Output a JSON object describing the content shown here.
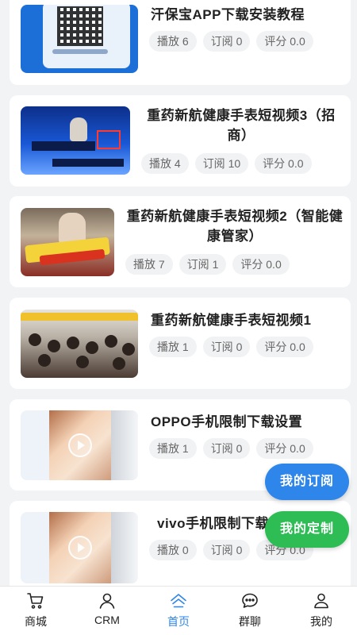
{
  "feed": {
    "items": [
      {
        "title": "汗保宝APP下载安装教程",
        "play": "播放 6",
        "subscribe": "订阅 0",
        "rating": "评分 0.0"
      },
      {
        "title": "重药新航健康手表短视频3（招商）",
        "play": "播放 4",
        "subscribe": "订阅 10",
        "rating": "评分 0.0"
      },
      {
        "title": "重药新航健康手表短视频2（智能健康管家）",
        "play": "播放 7",
        "subscribe": "订阅 1",
        "rating": "评分 0.0"
      },
      {
        "title": "重药新航健康手表短视频1",
        "play": "播放 1",
        "subscribe": "订阅 0",
        "rating": "评分 0.0"
      },
      {
        "title": "OPPO手机限制下载设置",
        "play": "播放 1",
        "subscribe": "订阅 0",
        "rating": "评分 0.0"
      },
      {
        "title": "vivo手机限制下载设置",
        "play": "播放 0",
        "subscribe": "订阅 0",
        "rating": "评分 0.0"
      }
    ]
  },
  "floating": {
    "my_subscriptions": "我的订阅",
    "my_customization": "我的定制"
  },
  "tabbar": {
    "items": [
      {
        "label": "商城",
        "icon": "cart-icon"
      },
      {
        "label": "CRM",
        "icon": "user-icon"
      },
      {
        "label": "首页",
        "icon": "home-icon"
      },
      {
        "label": "群聊",
        "icon": "chat-icon"
      },
      {
        "label": "我的",
        "icon": "profile-icon"
      }
    ],
    "active": "首页"
  },
  "colors": {
    "accent": "#2e86ea",
    "customize_green": "#2dbd54",
    "background": "#f2f3f5"
  }
}
